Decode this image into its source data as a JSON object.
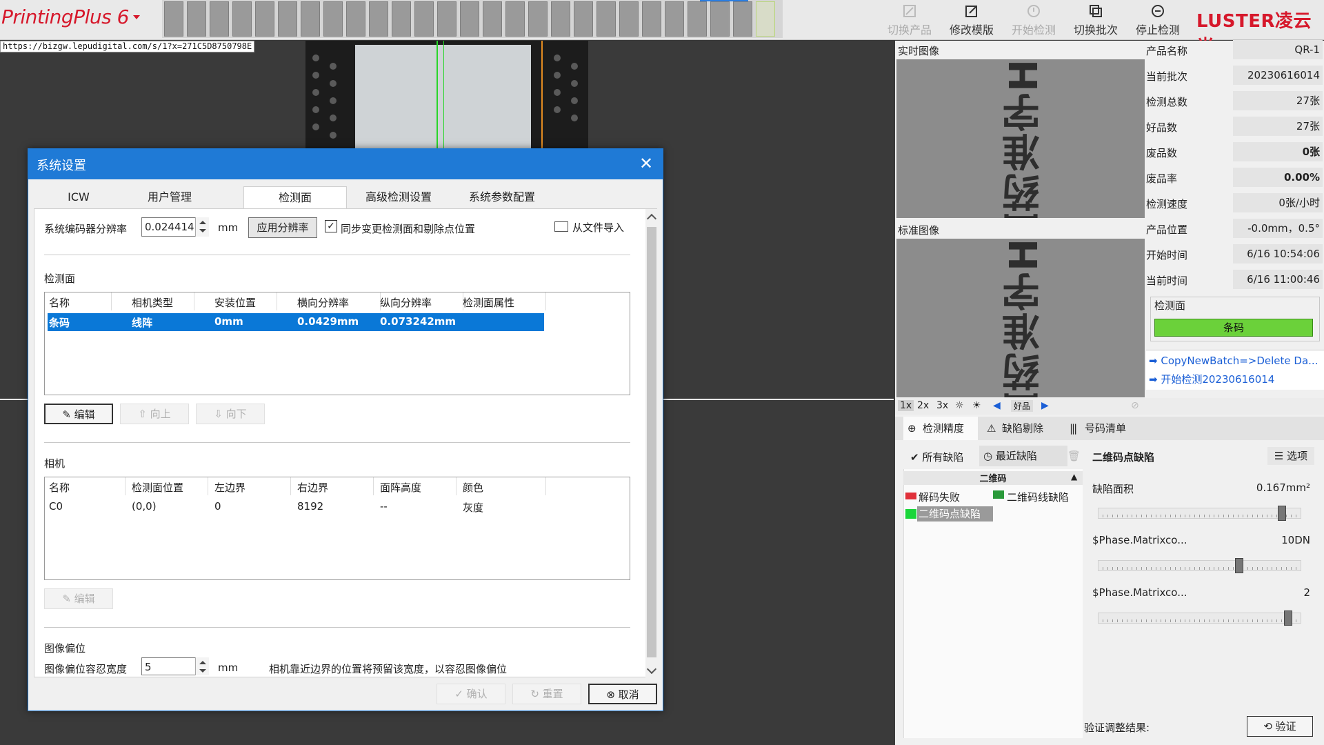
{
  "app": {
    "title": "PrintingPlus 6",
    "brand": "LUSTER凌云光",
    "url": "https://bizgw.lepudigital.com/s/1?x=271C5D8750798E"
  },
  "toolbar": {
    "switch_product": "切换产品",
    "edit_template": "修改模版",
    "start_detect": "开始检测",
    "switch_batch": "切换批次",
    "stop_detect": "停止检测"
  },
  "dialog": {
    "title": "系统设置",
    "tabs": [
      "ICW",
      "用户管理",
      "检测面",
      "高级检测设置",
      "系统参数配置"
    ],
    "active_tab": "检测面",
    "encoder_label": "系统编码器分辨率",
    "encoder_value": "0.024414",
    "encoder_unit": "mm",
    "apply_btn": "应用分辨率",
    "sync_checkbox": "同步变更检测面和剔除点位置",
    "import_btn": "从文件导入",
    "section_detect": "检测面",
    "detect_table": {
      "headers": [
        "名称",
        "相机类型",
        "安装位置",
        "横向分辨率",
        "纵向分辨率",
        "检测面属性"
      ],
      "rows": [
        [
          "条码",
          "线阵",
          "0mm",
          "0.0429mm",
          "0.073242mm",
          ""
        ]
      ]
    },
    "edit_btn": "编辑",
    "up_btn": "向上",
    "down_btn": "向下",
    "section_camera": "相机",
    "camera_table": {
      "headers": [
        "名称",
        "检测面位置",
        "左边界",
        "右边界",
        "面阵高度",
        "颜色"
      ],
      "rows": [
        [
          "C0",
          "(0,0)",
          "0",
          "8192",
          "--",
          "灰度"
        ]
      ]
    },
    "camera_edit_btn": "编辑",
    "section_offset": "图像偏位",
    "offset_label": "图像偏位容忍宽度",
    "offset_value": "5",
    "offset_unit": "mm",
    "offset_hint": "相机靠近边界的位置将预留该宽度，以容忍图像偏位",
    "confirm_btn": "确认",
    "reset_btn": "重置",
    "cancel_btn": "取消"
  },
  "right": {
    "live_image": "实时图像",
    "std_image": "标准图像",
    "image_text": "国药准字H",
    "info": [
      {
        "k": "产品名称",
        "v": "QR-1"
      },
      {
        "k": "当前批次",
        "v": "20230616014"
      },
      {
        "k": "检测总数",
        "v": "27张"
      },
      {
        "k": "好品数",
        "v": "27张"
      },
      {
        "k": "废品数",
        "v": "0张"
      },
      {
        "k": "废品率",
        "v": "0.00%"
      },
      {
        "k": "检测速度",
        "v": "0张/小时"
      },
      {
        "k": "产品位置",
        "v": "-0.0mm，0.5°"
      },
      {
        "k": "开始时间",
        "v": "6/16 10:54:06"
      },
      {
        "k": "当前时间",
        "v": "6/16 11:00:46"
      }
    ],
    "detect_group": "检测面",
    "detect_bar": "条码",
    "log": [
      "CopyNewBatch=>Delete Da...",
      "开始检测20230616014"
    ],
    "zoom": [
      "1x",
      "2x",
      "3x"
    ],
    "good_label": "好品",
    "tabs": [
      "检测精度",
      "缺陷剔除",
      "号码清单"
    ],
    "all_defects": "所有缺陷",
    "recent_defects": "最近缺陷",
    "list_header": "二维码",
    "defects": [
      "解码失败",
      "二维码线缺陷",
      "二维码点缺陷"
    ],
    "detail_title": "二维码点缺陷",
    "options_btn": "选项",
    "params": [
      {
        "name": "缺陷面积",
        "value": "0.167mm²",
        "level": 0.92
      },
      {
        "name": "$Phase.Matrixco...",
        "value": "10DN",
        "level": 0.7
      },
      {
        "name": "$Phase.Matrixco...",
        "value": "2",
        "level": 0.95
      }
    ],
    "verify_label": "验证调整结果:",
    "verify_btn": "验证"
  }
}
